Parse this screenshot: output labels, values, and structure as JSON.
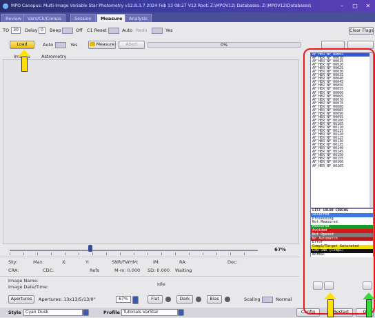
{
  "title": "MPO Canopus: Multi-Image Variable Star Photometry   v12.8.3.7 2024 Feb 13 08:27   V12 Root: Z:\\MPOV12\\   Databases: Z:\\MPOV12\\Databases\\",
  "tabs": [
    "Review",
    "Vars/Ck/Comps",
    "Session",
    "Measure",
    "Analysis"
  ],
  "active_tab": "Measure",
  "toolbar1": {
    "to_label": "TO",
    "to_value": "30",
    "delay_label": "Delay",
    "delay_value": "0",
    "beep_label": "Beep",
    "beep_state": "Off",
    "c1reset_label": "C1 Reset",
    "auto_label": "Auto",
    "redo_label": "Redo",
    "yes_label": "Yes",
    "clear_flags": "Clear Flags"
  },
  "toolbar2": {
    "load_label": "Load",
    "auto_label": "Auto",
    "yes_label": "Yes",
    "measure_label": "Measure",
    "abort_label": "Abort",
    "progress_text": "0%",
    "right_btn1": "",
    "right_btn2": ""
  },
  "subtabs": [
    "Images",
    "Astrometry"
  ],
  "zoom_percent": "67%",
  "status": {
    "sky": "Sky:",
    "max": "Max:",
    "x": "X:",
    "y": "Y:",
    "snr_fwhm": "SNR/FWHM:",
    "im": "IM:",
    "ra": "RA:",
    "dec": "Dec:",
    "cra": "CRA:",
    "cdc": "CDC:",
    "refs": "Refs",
    "mmo": "M-m: 0.000",
    "sd": "SD: 0.000",
    "waiting": "Waiting",
    "image_name": "Image Name:",
    "image_datetime": "Image Date/Time:",
    "idle": "Idle"
  },
  "bottom": {
    "apertures_btn": "Apertures",
    "apertures_text": "Apertures: 13x13/5/13/0°",
    "zoom_value": "67%",
    "flat_label": "Flat",
    "dark_label": "Dark",
    "bias_label": "Bias",
    "scaling_label": "Scaling",
    "normal_label": "Normal"
  },
  "stylebar": {
    "style_label": "Style",
    "style_value": "Cyan Dusk",
    "profile_label": "Profile",
    "profile_value": "Tutorials VarStar",
    "config_label": "Config",
    "restart_label": "Restart",
    "extra_label": "Q"
  },
  "image_list": [
    "AF_HER_NF_00005",
    "AF_HER_NF_00010",
    "AF_HER_NF_00015",
    "AF_HER_NF_00020",
    "AF_HER_NF_00025",
    "AF_HER_NF_00030",
    "AF_HER_NF_00035",
    "AF_HER_NF_00040",
    "AF_HER_NF_00045",
    "AF_HER_NF_00050",
    "AF_HER_NF_00055",
    "AF_HER_NF_00060",
    "AF_HER_NF_00065",
    "AF_HER_NF_00070",
    "AF_HER_NF_00075",
    "AF_HER_NF_00080",
    "AF_HER_NF_00085",
    "AF_HER_NF_00090",
    "AF_HER_NF_00095",
    "AF_HER_NF_00100",
    "AF_HER_NF_00105",
    "AF_HER_NF_00110",
    "AF_HER_NF_00115",
    "AF_HER_NF_00120",
    "AF_HER_NF_00125",
    "AF_HER_NF_00130",
    "AF_HER_NF_00135",
    "AF_HER_NF_00140",
    "AF_HER_NF_00145",
    "AF_HER_NF_00150",
    "AF_HER_NF_00155",
    "AF_HER_NF_00160",
    "AF_HER_NF_00165"
  ],
  "legend_title": "LIST COLOR CODING",
  "legend": [
    {
      "label": "Selected",
      "bg": "#3a7ae8",
      "fg": "#ffffff"
    },
    {
      "label": "Processing",
      "bg": "#ffffff",
      "fg": "#111111"
    },
    {
      "label": "Not Measured",
      "bg": "#ffffff",
      "fg": "#111111"
    },
    {
      "label": "Measured",
      "bg": "#1a9a2a",
      "fg": "#ffffff"
    },
    {
      "label": "Avoided",
      "bg": "#d81818",
      "fg": "#ffffff"
    },
    {
      "label": "Not Opened",
      "bg": "#7a7a7a",
      "fg": "#ffffff"
    },
    {
      "label": "No Automatch",
      "bg": "#b01a1a",
      "fg": "#ffffff"
    },
    {
      "label": "Error",
      "bg": "#ffffff",
      "fg": "#111111"
    },
    {
      "label": "Comp1/Target Saturated",
      "bg": "#f0e000",
      "fg": "#111111"
    },
    {
      "label": "Low SNR (Comp1)",
      "bg": "#111111",
      "fg": "#ffffff"
    },
    {
      "label": "Normal",
      "bg": "#ffffff",
      "fg": "#111111"
    }
  ],
  "colors": {
    "highlight_frame": "#e8151a",
    "arrow_yellow": "#ffe000",
    "arrow_green": "#3ad83a"
  }
}
